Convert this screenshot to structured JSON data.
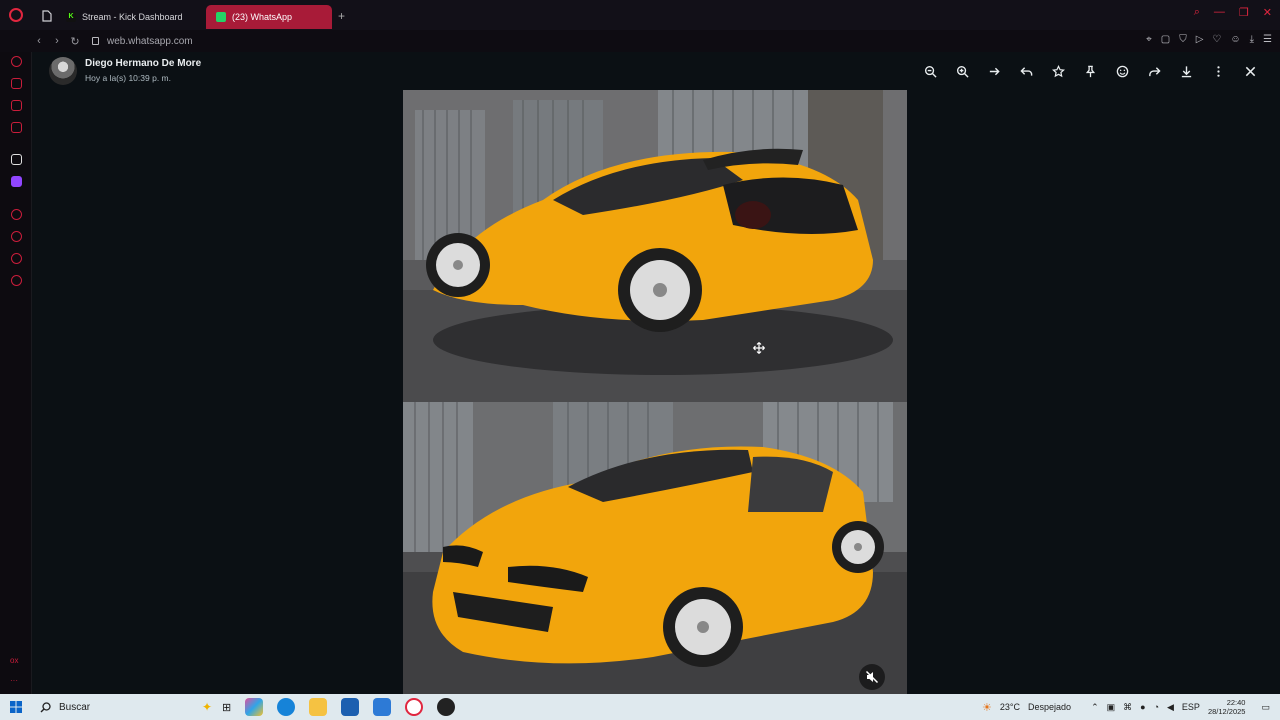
{
  "browser": {
    "tabs": [
      {
        "label": "Stream - Kick Dashboard",
        "active": false
      },
      {
        "label": "(23) WhatsApp",
        "active": true
      }
    ],
    "url_host": "web.whatsapp.com",
    "accent_color": "#c91d3b"
  },
  "sidebar": {
    "footer_label": "ox"
  },
  "viewer": {
    "sender_name": "Diego Hermano De More",
    "sent_time": "Hoy a la(s) 10:39 p. m.",
    "toolbar": [
      "zoom-out-icon",
      "zoom-in-icon",
      "arrow-right-icon",
      "reply-icon",
      "star-icon",
      "pin-icon",
      "emoji-icon",
      "forward-icon",
      "download-icon",
      "more-vert-icon",
      "close-icon"
    ],
    "media": {
      "description_icon": "video-muted-icon",
      "car_color": "#f2a50c"
    }
  },
  "taskbar": {
    "search_placeholder": "Buscar",
    "weather_temp": "23°C",
    "weather_desc": "Despejado",
    "language": "ESP",
    "time": "22:40",
    "date": "28/12/2025"
  }
}
